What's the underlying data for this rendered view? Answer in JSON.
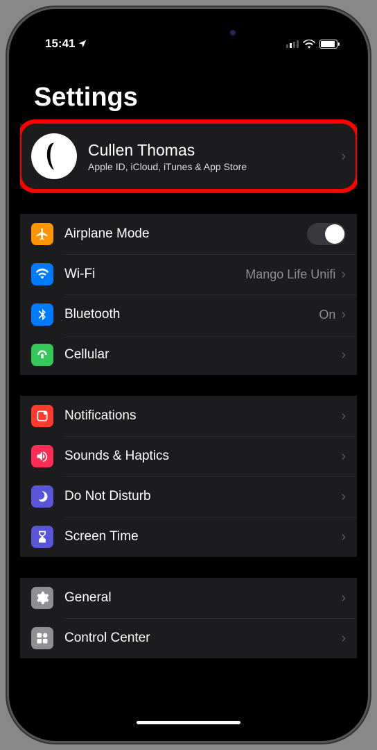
{
  "status": {
    "time": "15:41"
  },
  "title": "Settings",
  "profile": {
    "name": "Cullen Thomas",
    "subtitle": "Apple ID, iCloud, iTunes & App Store"
  },
  "group1": {
    "airplane": {
      "label": "Airplane Mode"
    },
    "wifi": {
      "label": "Wi-Fi",
      "value": "Mango Life Unifi"
    },
    "bluetooth": {
      "label": "Bluetooth",
      "value": "On"
    },
    "cellular": {
      "label": "Cellular"
    }
  },
  "group2": {
    "notifications": {
      "label": "Notifications"
    },
    "sounds": {
      "label": "Sounds & Haptics"
    },
    "dnd": {
      "label": "Do Not Disturb"
    },
    "screentime": {
      "label": "Screen Time"
    }
  },
  "group3": {
    "general": {
      "label": "General"
    },
    "controlcenter": {
      "label": "Control Center"
    }
  }
}
